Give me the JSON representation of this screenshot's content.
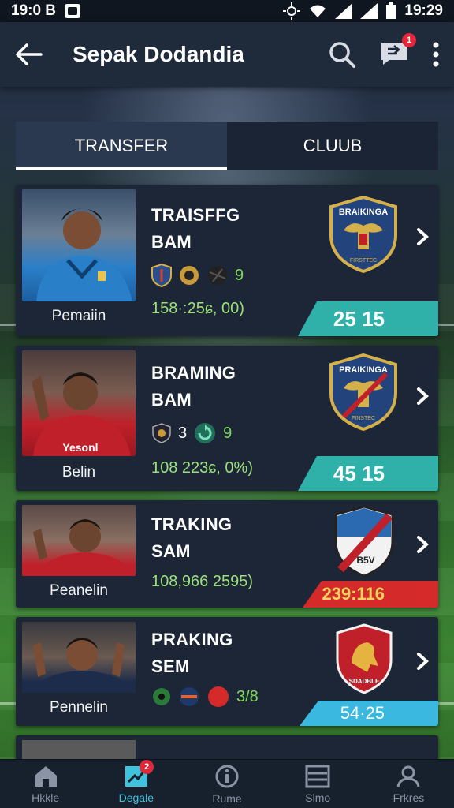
{
  "status_bar": {
    "time_left": "19:0 B",
    "time_right": "19:29"
  },
  "app_bar": {
    "title": "Sepak Dodandia",
    "notification_count": "1"
  },
  "tabs": [
    {
      "label": "TRANSFER",
      "active": true
    },
    {
      "label": "CLUUB",
      "active": false
    }
  ],
  "cards": [
    {
      "player_name": "Pemaiin",
      "title_line1": "TRAISFFG",
      "title_line2": "BAM",
      "icon_count": "9",
      "stat": "158·:25ɕ, 00)",
      "score": "25 15",
      "score_color": "#2fb1a9",
      "jersey_color": "#2a7fc9"
    },
    {
      "player_name": "Belin",
      "title_line1": "BRAMING",
      "title_line2": "BAM",
      "icon_count": "9",
      "icon_extra": "3",
      "stat": "108 223ɕ, 0%)",
      "score": "45 15",
      "score_color": "#2fb1a9",
      "jersey_color": "#c0202a"
    },
    {
      "player_name": "Peanelin",
      "title_line1": "TRAKING",
      "title_line2": "SAM",
      "stat": "108,966 2595)",
      "score": "239:116",
      "score_color": "#d42a2a",
      "crest_text": "B5V",
      "jersey_color": "#c0202a"
    },
    {
      "player_name": "Pennelin",
      "title_line1": "PRAKING",
      "title_line2": "SEM",
      "icon_count": "3/8",
      "score": "54·25",
      "score_color": "#3ab8e0",
      "crest_text": "SDADBLE",
      "jersey_color": "#1d2c4a"
    }
  ],
  "crest_labels": {
    "eagle_top": "BRAIKINGA",
    "eagle_bottom": "FIRSTTEC",
    "eagle2_top": "PRAIKINGA",
    "eagle2_bottom": "FINSTEC"
  },
  "bottom_nav": [
    {
      "label": "Hkkle",
      "icon": "home-icon"
    },
    {
      "label": "Degale",
      "icon": "chart-icon",
      "active": true,
      "badge": "2"
    },
    {
      "label": "Rume",
      "icon": "info-icon"
    },
    {
      "label": "Slmo",
      "icon": "list-icon"
    },
    {
      "label": "Frkres",
      "icon": "profile-icon"
    }
  ]
}
